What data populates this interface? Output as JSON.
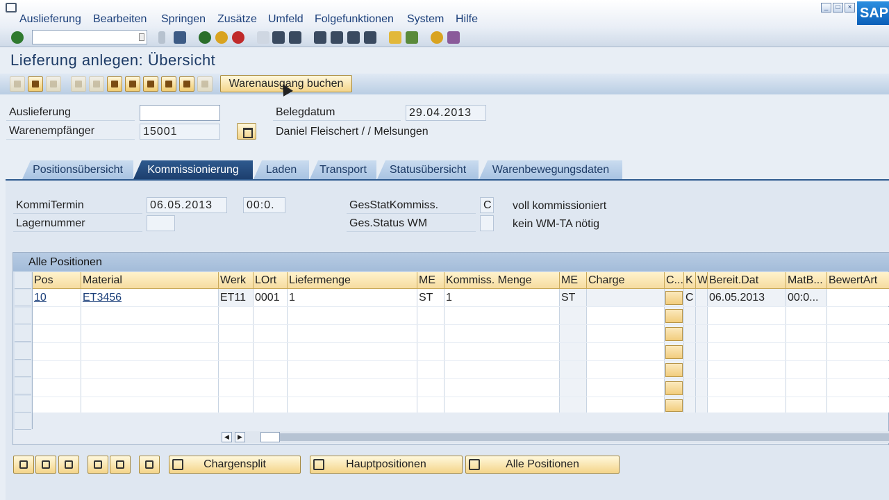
{
  "menu": [
    "Auslieferung",
    "Bearbeiten",
    "Springen",
    "Zusätze",
    "Umfeld",
    "Folgefunktionen",
    "System",
    "Hilfe"
  ],
  "logo": "SAP",
  "title": "Lieferung  anlegen: Übersicht",
  "app_toolbar": {
    "post_goods_issue": "Warenausgang buchen"
  },
  "header": {
    "delivery_label": "Auslieferung",
    "delivery_value": "",
    "ship_to_label": "Warenempfänger",
    "ship_to_value": "15001",
    "doc_date_label": "Belegdatum",
    "doc_date_value": "29.04.2013",
    "ship_to_name": "Daniel Fleischert / / Melsungen"
  },
  "tabs": [
    "Positionsübersicht",
    "Kommissionierung",
    "Laden",
    "Transport",
    "Statusübersicht",
    "Warenbewegungsdaten"
  ],
  "active_tab": "Kommissionierung",
  "picking": {
    "date_label": "KommiTermin",
    "date_value": "06.05.2013",
    "time_value": "00:0.",
    "warehouse_label": "Lagernummer",
    "warehouse_value": "",
    "overall_status_label": "GesStatKommiss.",
    "overall_status_value": "C",
    "overall_status_text": "voll kommissioniert",
    "wm_status_label": "Ges.Status WM",
    "wm_status_value": "",
    "wm_status_text": "kein WM-TA nötig"
  },
  "grid": {
    "title": "Alle Positionen",
    "columns": [
      "Pos",
      "Material",
      "Werk",
      "LOrt",
      "Liefermenge",
      "ME",
      "Kommiss. Menge",
      "ME",
      "Charge",
      "C...",
      "K",
      "W",
      "Bereit.Dat",
      "MatB...",
      "BewertArt"
    ],
    "rows": [
      {
        "pos": "10",
        "material": "ET3456",
        "werk": "ET11",
        "lort": "0001",
        "liefermenge": "1",
        "me": "ST",
        "kommiss_menge": "1",
        "me2": "ST",
        "charge": "",
        "k": "C",
        "bereit_dat": "06.05.2013",
        "matb": "00:0...",
        "bewertart": ""
      }
    ]
  },
  "bottom_buttons": {
    "batch_split": "Chargensplit",
    "main_items": "Hauptpositionen",
    "all_items": "Alle Positionen"
  },
  "colors": {
    "tab_active": "#1d3f6e",
    "button_face": "#f4d58a",
    "title_text": "#1d3b66"
  }
}
